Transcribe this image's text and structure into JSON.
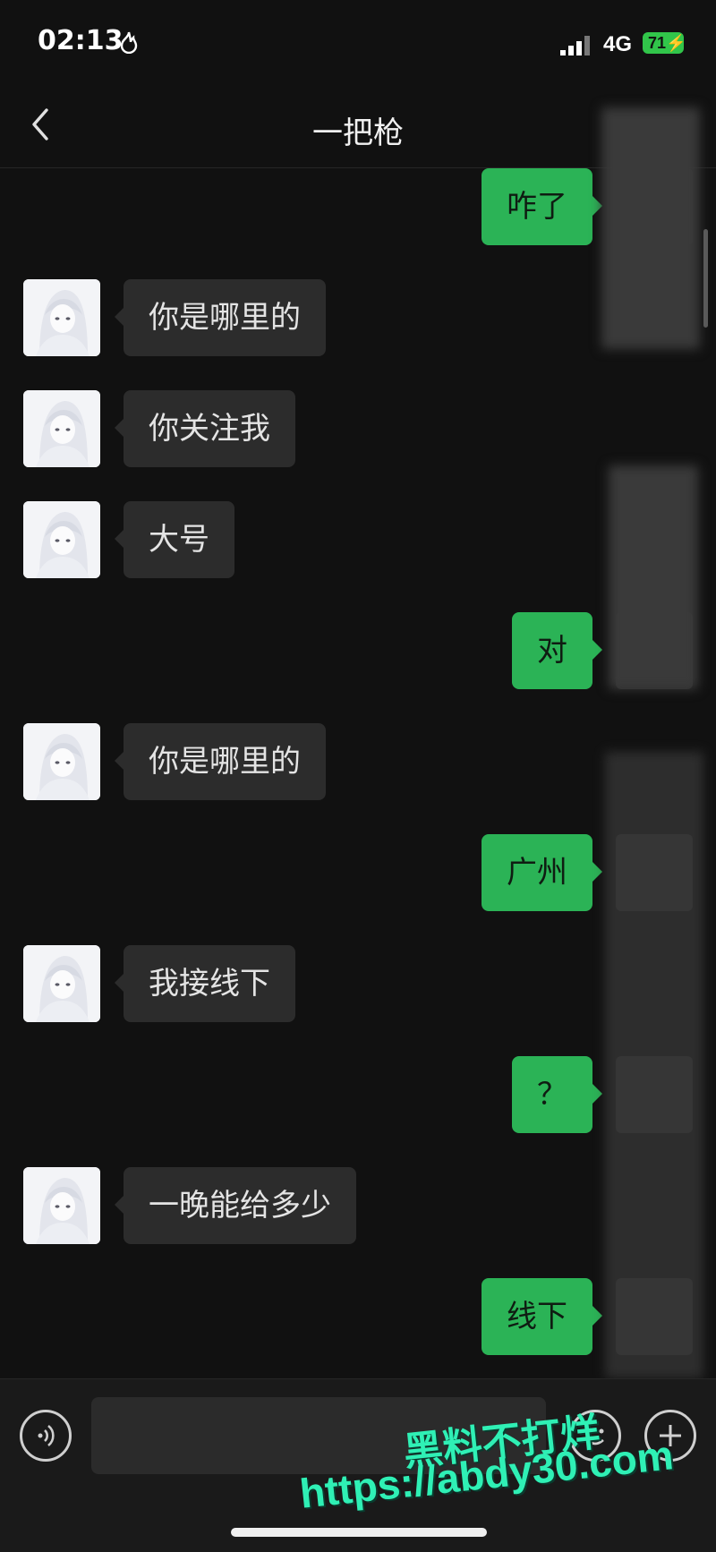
{
  "status_bar": {
    "time": "02:13",
    "network": "4G",
    "battery": "71"
  },
  "header": {
    "title": "一把枪"
  },
  "messages": [
    {
      "side": "out",
      "text": "咋了"
    },
    {
      "side": "in",
      "text": "你是哪里的"
    },
    {
      "side": "in",
      "text": "你关注我"
    },
    {
      "side": "in",
      "text": "大号"
    },
    {
      "side": "out",
      "text": "对"
    },
    {
      "side": "in",
      "text": "你是哪里的"
    },
    {
      "side": "out",
      "text": "广州"
    },
    {
      "side": "in",
      "text": "我接线下"
    },
    {
      "side": "out",
      "text": "？"
    },
    {
      "side": "in",
      "text": "一晚能给多少"
    },
    {
      "side": "out",
      "text": "线下"
    }
  ],
  "watermark": {
    "line1": "黑料不打烊",
    "line2": "https://abdy30.com"
  },
  "colors": {
    "background": "#111111",
    "incoming_bubble": "#2c2c2c",
    "outgoing_bubble": "#2bb356",
    "watermark": "#2ff0b5"
  },
  "icons": {
    "back": "chevron-left-icon",
    "voice": "voice-icon",
    "emoji": "emoji-icon",
    "plus": "plus-icon"
  }
}
